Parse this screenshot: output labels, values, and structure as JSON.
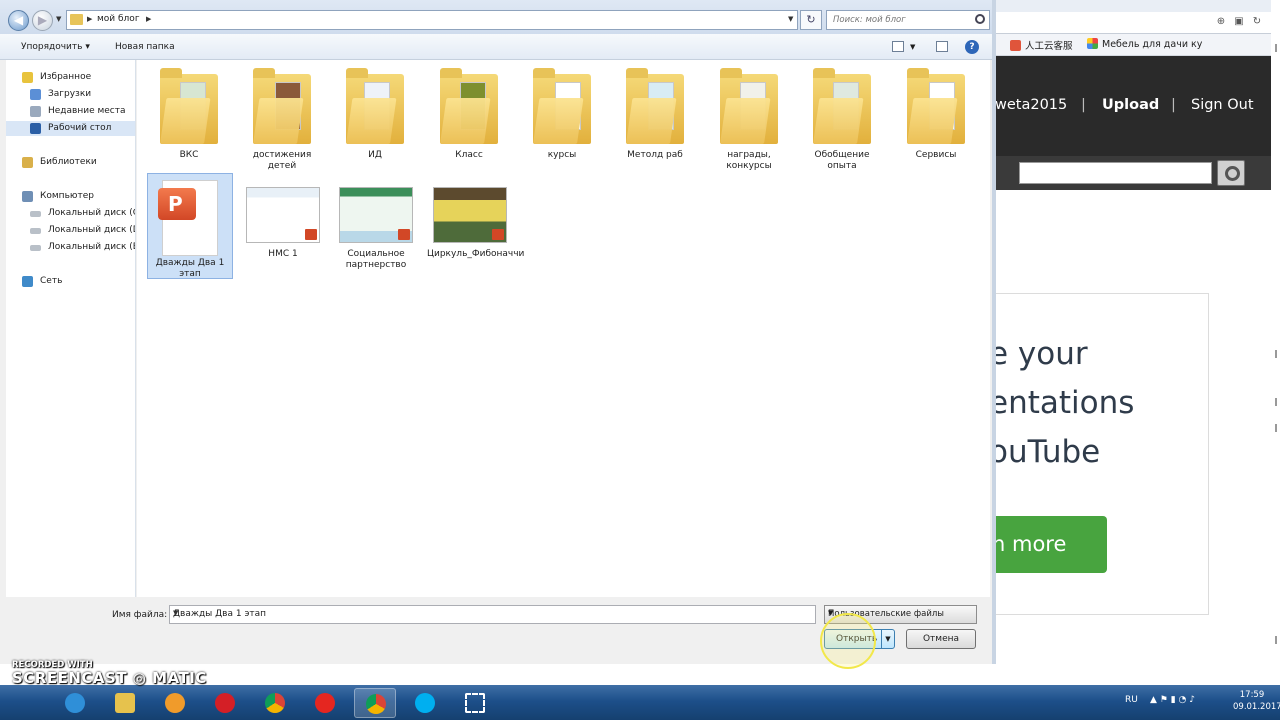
{
  "dialog": {
    "breadcrumb": {
      "segments": [
        "мой блог"
      ]
    },
    "search_placeholder": "Поиск: мой блог",
    "toolbar": {
      "organize": "Упорядочить",
      "new_folder": "Новая папка",
      "help": "?"
    },
    "nav": {
      "favorites": "Избранное",
      "downloads": "Загрузки",
      "recent": "Недавние места",
      "desktop": "Рабочий стол",
      "libraries": "Библиотеки",
      "computer": "Компьютер",
      "disk_c": "Локальный диск (C",
      "disk_d": "Локальный диск (D",
      "disk_e": "Локальный диск (E:",
      "network": "Сеть"
    },
    "folders": [
      {
        "label": "ВКС"
      },
      {
        "label": "достижения детей"
      },
      {
        "label": "ИД"
      },
      {
        "label": "Класс"
      },
      {
        "label": "курсы"
      },
      {
        "label": "Метолд раб"
      },
      {
        "label": "награды, конкурсы"
      },
      {
        "label": "Обобщение опыта"
      },
      {
        "label": "Сервисы"
      }
    ],
    "files": [
      {
        "label": "Дважды Два 1 этап",
        "selected": true
      },
      {
        "label": "НМС 1"
      },
      {
        "label": "Социальное партнерство"
      },
      {
        "label": "Циркуль_Фибоначчи"
      }
    ],
    "filename_label": "Имя файла:",
    "filename_value": "Дважды Два 1 этап",
    "filter": "Пользовательские файлы",
    "open": "Открыть",
    "cancel": "Отмена"
  },
  "browser": {
    "favorites": [
      "人工云客服",
      "Мебель для дачи ку"
    ],
    "nav": {
      "user": "weta2015",
      "upload": "Upload",
      "signout": "Sign Out"
    },
    "hero": [
      "e your",
      "entations",
      "ouTube"
    ],
    "learn": "n more"
  },
  "taskbar": {
    "lang": "RU",
    "time": "17:59",
    "date": "09.01.2017"
  },
  "watermark": {
    "line1": "RECORDED WITH",
    "line2": "SCREENCAST",
    "line3": "MATIC"
  }
}
